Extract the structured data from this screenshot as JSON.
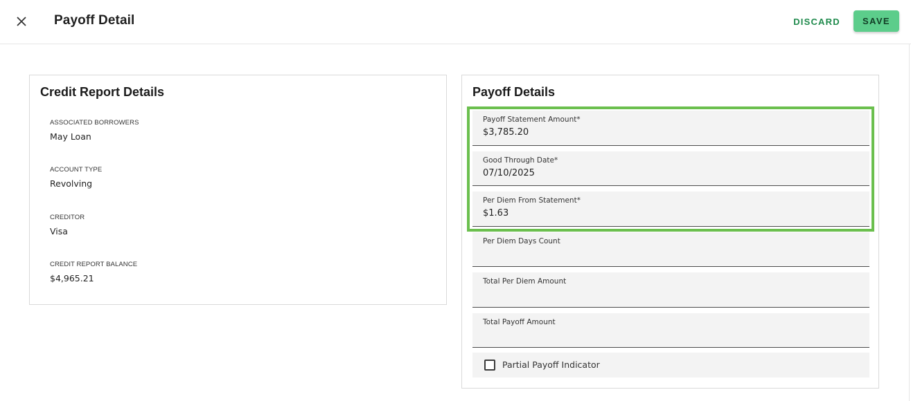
{
  "header": {
    "title": "Payoff Detail",
    "discard_label": "DISCARD",
    "save_label": "SAVE",
    "close_icon": "close-icon"
  },
  "credit_report": {
    "title": "Credit Report Details",
    "items": [
      {
        "label": "ASSOCIATED BORROWERS",
        "value": "May Loan"
      },
      {
        "label": "ACCOUNT TYPE",
        "value": "Revolving"
      },
      {
        "label": "CREDITOR",
        "value": "Visa"
      },
      {
        "label": "CREDIT REPORT BALANCE",
        "value": "$4,965.21"
      }
    ]
  },
  "payoff": {
    "title": "Payoff Details",
    "fields": [
      {
        "label": "Payoff Statement Amount*",
        "value": "$3,785.20"
      },
      {
        "label": "Good Through Date*",
        "value": "07/10/2025"
      },
      {
        "label": "Per Diem From Statement*",
        "value": "$1.63"
      },
      {
        "label": "Per Diem Days Count",
        "value": ""
      },
      {
        "label": "Total Per Diem Amount",
        "value": ""
      },
      {
        "label": "Total Payoff Amount",
        "value": ""
      }
    ],
    "partial_payoff_label": "Partial Payoff Indicator",
    "partial_payoff_checked": false
  },
  "colors": {
    "accent": "#1f8a4c",
    "save_button": "#5ccd8b",
    "highlight": "#6bbf4e"
  }
}
